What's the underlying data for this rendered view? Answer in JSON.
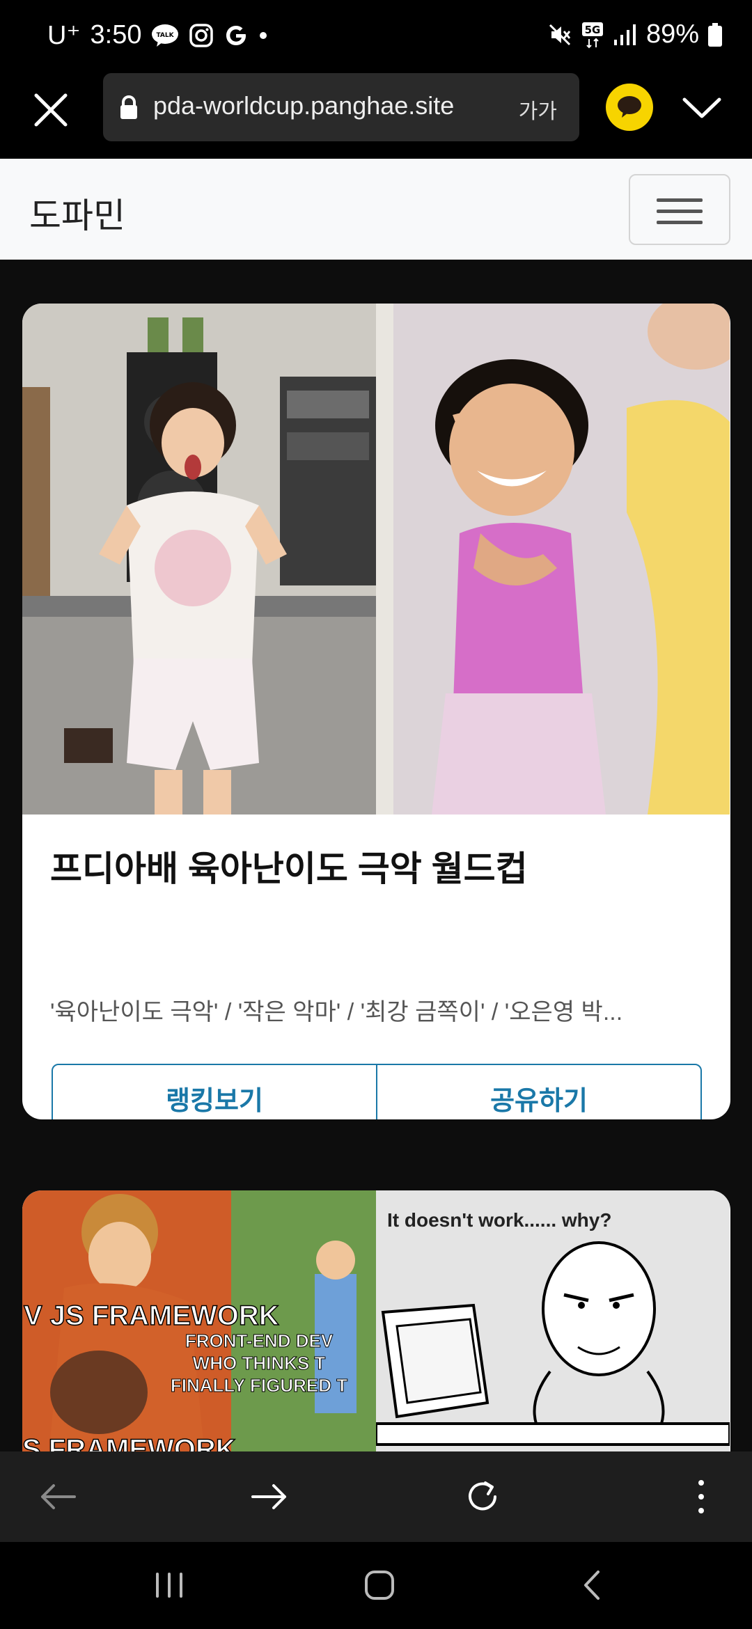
{
  "status_bar": {
    "carrier": "U⁺",
    "time": "3:50",
    "battery": "89%",
    "icons": [
      "talk-icon",
      "instagram-icon",
      "google-icon",
      "dot-icon",
      "mute-icon",
      "5g-icon",
      "signal-icon",
      "battery-icon"
    ],
    "talk_label": "TALK",
    "net_label": "5G"
  },
  "browser": {
    "url": "pda-worldcup.panghae.site",
    "font_size_label": "가가",
    "icons": [
      "close-icon",
      "lock-icon",
      "kakaotalk-icon",
      "chevron-down-icon"
    ]
  },
  "site_nav": {
    "brand": "도파민"
  },
  "cards": [
    {
      "title": "프디아배 육아난이도 극악 월드컵",
      "description": "'육아난이도 극악' / '작은 악마' / '최강 금쪽이' / '오은영 박...",
      "buttons": {
        "ranking": "랭킹보기",
        "share": "공유하기"
      }
    },
    {
      "meme_left_top": "V JS FRAMEWORK",
      "meme_left_mid1": "FRONT-END DEV",
      "meme_left_mid2": "WHO THINKS T",
      "meme_left_mid3": "FINALLY FIGURED T",
      "meme_left_bottom": "S FRAMEWORK",
      "meme_right": "It doesn't work...... why?"
    }
  ],
  "toolbar": {
    "icons": [
      "back-icon",
      "forward-icon",
      "refresh-icon",
      "more-icon"
    ]
  },
  "sys_nav": {
    "icons": [
      "recents-icon",
      "home-icon",
      "back-nav-icon"
    ]
  },
  "colors": {
    "accent": "#1a78a8",
    "kakao_yellow": "#f7d400"
  }
}
